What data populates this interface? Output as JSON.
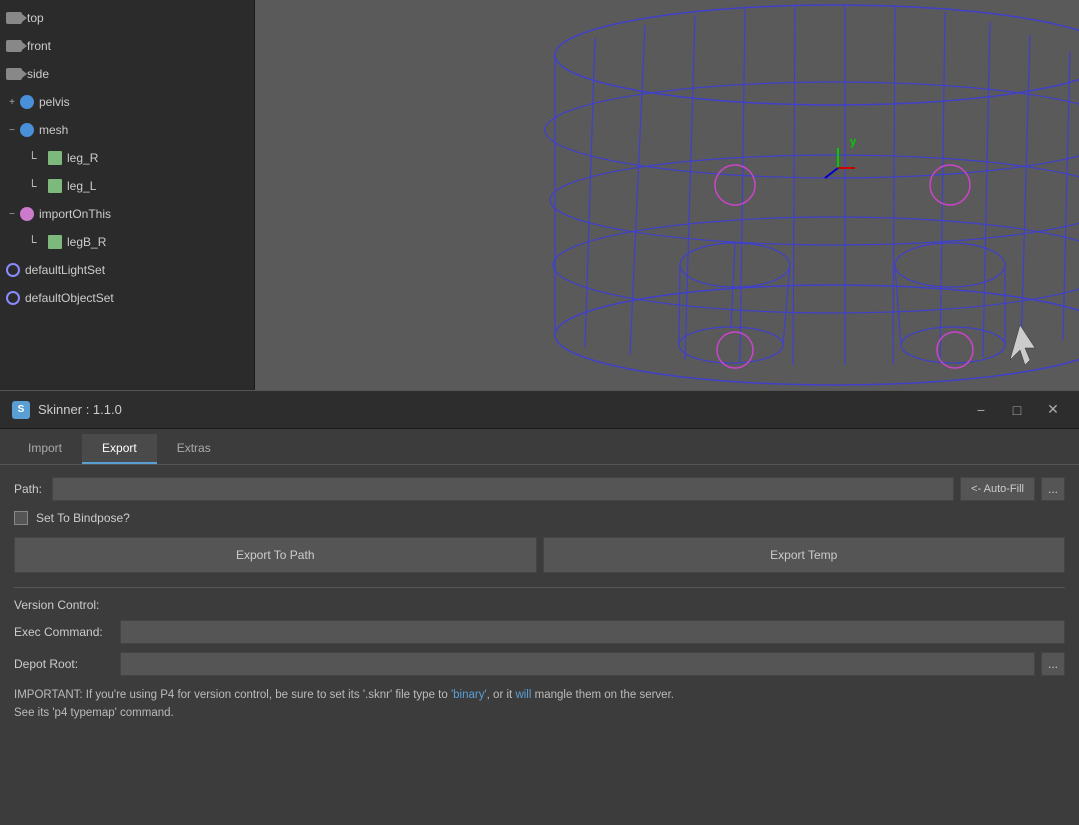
{
  "viewport": {
    "outliner": {
      "items": [
        {
          "id": "top",
          "label": "top",
          "type": "camera",
          "indent": 0
        },
        {
          "id": "front",
          "label": "front",
          "type": "camera",
          "indent": 0
        },
        {
          "id": "side",
          "label": "side",
          "type": "camera",
          "indent": 0
        },
        {
          "id": "pelvis",
          "label": "pelvis",
          "type": "joint",
          "indent": 0,
          "expanded": true
        },
        {
          "id": "mesh",
          "label": "mesh",
          "type": "joint",
          "indent": 0,
          "expanded": true
        },
        {
          "id": "leg_R",
          "label": "leg_R",
          "type": "mesh",
          "indent": 1
        },
        {
          "id": "leg_L",
          "label": "leg_L",
          "type": "mesh",
          "indent": 1
        },
        {
          "id": "importOnThis",
          "label": "importOnThis",
          "type": "joint",
          "indent": 0,
          "expanded": true
        },
        {
          "id": "legB_R",
          "label": "legB_R",
          "type": "mesh",
          "indent": 1
        },
        {
          "id": "defaultLightSet",
          "label": "defaultLightSet",
          "type": "set",
          "indent": 0
        },
        {
          "id": "defaultObjectSet",
          "label": "defaultObjectSet",
          "type": "set",
          "indent": 0
        }
      ]
    }
  },
  "titleBar": {
    "appIcon": "S",
    "title": "Skinner : 1.1.0",
    "minimizeLabel": "−",
    "maximizeLabel": "□",
    "closeLabel": "✕"
  },
  "tabs": [
    {
      "id": "import",
      "label": "Import",
      "active": false
    },
    {
      "id": "export",
      "label": "Export",
      "active": true
    },
    {
      "id": "extras",
      "label": "Extras",
      "active": false
    }
  ],
  "export": {
    "pathLabel": "Path:",
    "pathPlaceholder": "",
    "pathValue": "",
    "autoFillLabel": "<- Auto-Fill",
    "dotsLabel": "...",
    "checkboxLabel": "Set To Bindpose?",
    "exportToPathLabel": "Export To Path",
    "exportTempLabel": "Export Temp",
    "versionControlLabel": "Version Control:",
    "execCommandLabel": "Exec Command:",
    "execCommandValue": "",
    "depotRootLabel": "Depot Root:",
    "depotRootValue": "",
    "depotDotsLabel": "...",
    "importantNote1": "IMPORTANT: If you're using P4 for version control, be sure to set its '.sknr' file type to 'binary', or it will mangle them on the server.",
    "importantNote2": "See its 'p4 typemap' command.",
    "highlightWord1": "'binary'",
    "highlightWord2": "will"
  }
}
